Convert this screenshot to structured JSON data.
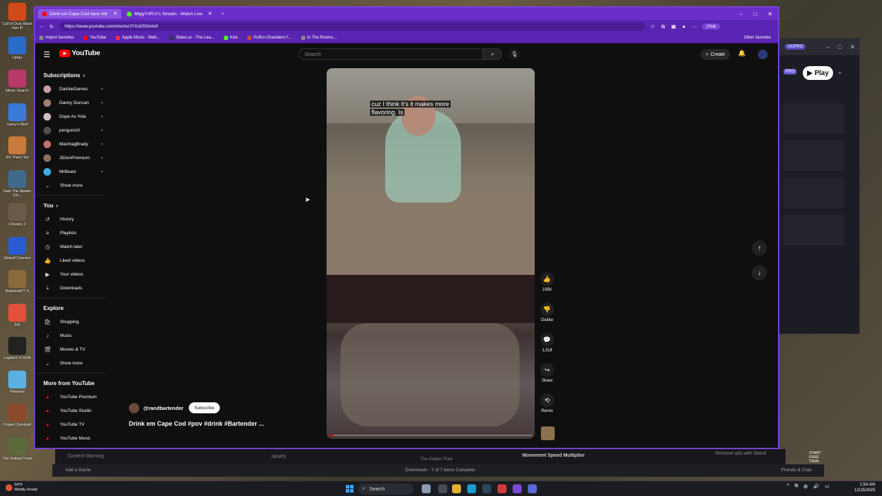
{
  "desktop": {
    "icons": [
      {
        "label": "Call of Duty Black Ops III",
        "color": "#d04a1a"
      },
      {
        "label": "Uplay",
        "color": "#2a6ac8"
      },
      {
        "label": "Mimic Search",
        "color": "#b83a6a"
      },
      {
        "label": "Garry's Mod",
        "color": "#3a7ad8"
      },
      {
        "label": "RV There Yet",
        "color": "#c87a3a"
      },
      {
        "label": "Halo The Master Chi...",
        "color": "#406a8a"
      },
      {
        "label": "Chivalry 2",
        "color": "#6a5a4a"
      },
      {
        "label": "Ubisoft Connect",
        "color": "#2a5ad0"
      },
      {
        "label": "Battlefield™ 6",
        "color": "#8a6a3a"
      },
      {
        "label": "EA",
        "color": "#e0503a"
      },
      {
        "label": "Logitech G HUB",
        "color": "#222222"
      },
      {
        "label": "Palworld",
        "color": "#5ab0e0"
      },
      {
        "label": "Project Zomboid",
        "color": "#8a4a2a"
      },
      {
        "label": "The Outlast Trials",
        "color": "#5a6a3a"
      }
    ]
  },
  "browser": {
    "tabs": [
      {
        "title": "Drink em Cape Cod #pov #dr",
        "favicon": "#ff0000",
        "active": true
      },
      {
        "title": "MiggYnPLV's Stream - Watch Live",
        "favicon": "#53fc18",
        "active": false
      }
    ],
    "new_tab": "+",
    "controls": {
      "minimize": "–",
      "maximize": "□",
      "close": "✕"
    },
    "url": "https://www.youtube.com/shorts/JYXo0S3oVe0",
    "chat_label": "Chat",
    "favorites": [
      {
        "label": "Import favorites",
        "color": "#888888"
      },
      {
        "label": "YouTube",
        "color": "#ff0000"
      },
      {
        "label": "Apple Music - Web...",
        "color": "#fa2d48"
      },
      {
        "label": "Stake.us - The Lea...",
        "color": "#2a3a4a"
      },
      {
        "label": "Kick",
        "color": "#53fc18"
      },
      {
        "label": "Puffco Chambers f...",
        "color": "#c84a3a"
      },
      {
        "label": "In The Rooms...",
        "color": "#8a8a8a"
      }
    ],
    "other_favorites": "Other favorites"
  },
  "youtube": {
    "logo_text": "YouTube",
    "search_placeholder": "Search",
    "create_label": "Create",
    "subscriptions_title": "Subscriptions",
    "subscriptions": [
      {
        "name": "DashieGames",
        "color": "#c8a0a0",
        "live": true
      },
      {
        "name": "Danny Duncan",
        "color": "#a08070",
        "live": true
      },
      {
        "name": "Dope As Yola",
        "color": "#d0c0c0",
        "live": true
      },
      {
        "name": "penguinz0",
        "color": "#505050",
        "live": true
      },
      {
        "name": "MashtagBrady",
        "color": "#c07070",
        "live": true
      },
      {
        "name": "JiDionPremium",
        "color": "#907060",
        "live": true
      },
      {
        "name": "MrBeast",
        "color": "#3ab0e0",
        "live": true
      }
    ],
    "show_more": "Show more",
    "you_title": "You",
    "you_items": [
      {
        "label": "History",
        "icon": "history-icon",
        "glyph": "↺"
      },
      {
        "label": "Playlists",
        "icon": "playlists-icon",
        "glyph": "≡"
      },
      {
        "label": "Watch later",
        "icon": "clock-icon",
        "glyph": "◷"
      },
      {
        "label": "Liked videos",
        "icon": "thumbs-up-icon",
        "glyph": "👍"
      },
      {
        "label": "Your videos",
        "icon": "video-icon",
        "glyph": "▶"
      },
      {
        "label": "Downloads",
        "icon": "download-icon",
        "glyph": "⤓"
      }
    ],
    "explore_title": "Explore",
    "explore_items": [
      {
        "label": "Shopping",
        "icon": "shopping-bag-icon",
        "glyph": "🛍"
      },
      {
        "label": "Music",
        "icon": "music-note-icon",
        "glyph": "♪"
      },
      {
        "label": "Movies & TV",
        "icon": "film-icon",
        "glyph": "🎬"
      }
    ],
    "more_title": "More from YouTube",
    "more_items": [
      {
        "label": "YouTube Premium"
      },
      {
        "label": "YouTube Studio"
      },
      {
        "label": "YouTube TV"
      },
      {
        "label": "YouTube Music"
      }
    ],
    "short": {
      "caption_line1": "cuz I think it's it makes more",
      "caption_line2": "flavoring. Is",
      "channel": "@randbartender",
      "subscribe_label": "Subscribe",
      "title": "Drink em Cape Cod #pov #drink #Bartender ...",
      "progress": 0.02
    },
    "actions": [
      {
        "label": "235K",
        "icon": "thumbs-up-icon",
        "glyph": "👍",
        "name": "like"
      },
      {
        "label": "Dislike",
        "icon": "thumbs-down-icon",
        "glyph": "👎",
        "name": "dislike"
      },
      {
        "label": "1,518",
        "icon": "comment-icon",
        "glyph": "💬",
        "name": "comments"
      },
      {
        "label": "Share",
        "icon": "share-icon",
        "glyph": "↪",
        "name": "share"
      },
      {
        "label": "Remix",
        "icon": "remix-icon",
        "glyph": "⟲",
        "name": "remix"
      }
    ]
  },
  "bg_app": {
    "badge": "GOPRO",
    "pro": "PRO",
    "play_label": "Play",
    "strip1_left": "Content Warning",
    "strip1_mid": "NEWS",
    "strip1_game": "The Outlast Trials",
    "strip1_right": "Movement Speed Multiplier",
    "strip1_ads": "Remove ads with Wand",
    "strip1_trial": "START FREE TRIAL →",
    "strip2_left": "Add a Game",
    "strip2_mid": "Downloads - 7 of 7 Items Complete",
    "strip2_right": "Friends & Chat"
  },
  "taskbar": {
    "weather_temp": "54°F",
    "weather_desc": "Mostly cloudy",
    "search_label": "Search",
    "time": "1:54 AM",
    "date": "12/15/2025"
  }
}
